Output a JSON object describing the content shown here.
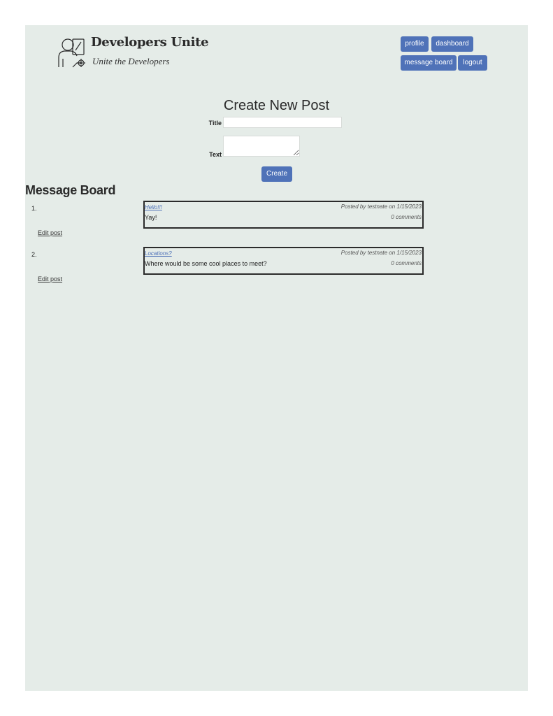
{
  "header": {
    "brand_title": "Developers Unite",
    "tagline": "Unite the Developers",
    "logo_icon": "developer-logo-icon"
  },
  "nav": {
    "profile": "profile",
    "dashboard": "dashboard",
    "message_board": "message board",
    "logout": "logout"
  },
  "create_post": {
    "heading": "Create New Post",
    "title_label": "Title",
    "title_value": "",
    "text_label": "Text",
    "text_value": "",
    "submit_label": "Create"
  },
  "board": {
    "heading": "Message Board",
    "posts": [
      {
        "number": "1.",
        "title": "Hello!!!",
        "meta": "Posted by testnate on 1/15/2023",
        "body": "Yay!",
        "comments": "0 comments",
        "edit_label": "Edit post"
      },
      {
        "number": "2.",
        "title": "Locations?",
        "meta": "Posted by testnate on 1/15/2023",
        "body": "Where would be some cool places to meet?",
        "comments": "0 comments",
        "edit_label": "Edit post"
      }
    ]
  },
  "colors": {
    "background": "#e5ece8",
    "accent": "#4f72b8",
    "border": "#2b2b2b"
  }
}
